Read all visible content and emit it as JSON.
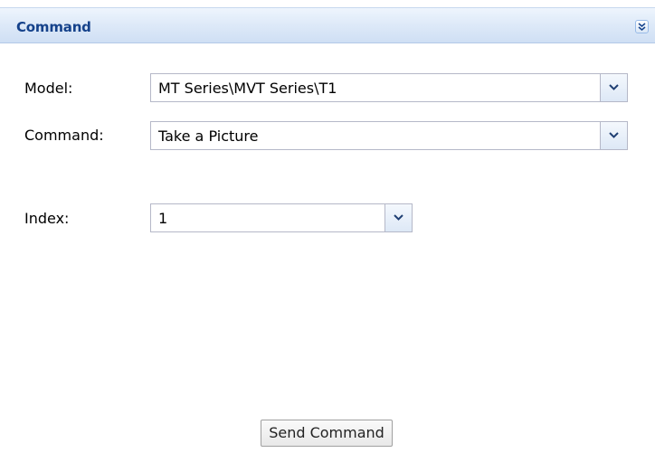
{
  "panel": {
    "title": "Command",
    "collapse_icon": "double-chevron-down-icon"
  },
  "form": {
    "model": {
      "label": "Model:",
      "value": "MT Series\\MVT Series\\T1"
    },
    "command": {
      "label": "Command:",
      "value": "Take a Picture"
    },
    "index": {
      "label": "Index:",
      "value": "1"
    }
  },
  "actions": {
    "send_label": "Send Command"
  },
  "colors": {
    "header_title": "#15428b",
    "header_bg": "#dde9f8",
    "field_border": "#b5b8c8"
  }
}
